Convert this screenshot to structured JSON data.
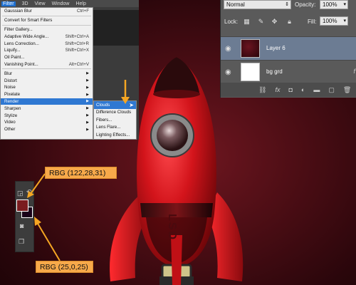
{
  "menubar": {
    "items": [
      "Filter",
      "3D",
      "View",
      "Window",
      "Help"
    ],
    "active": "Filter"
  },
  "filter_menu": {
    "top_item": {
      "label": "Gaussian Blur",
      "shortcut": "Ctrl+F"
    },
    "smart": "Convert for Smart Filters",
    "group1": [
      {
        "label": "Filter Gallery...",
        "shortcut": ""
      },
      {
        "label": "Adaptive Wide Angle...",
        "shortcut": "Shift+Ctrl+A"
      },
      {
        "label": "Lens Correction...",
        "shortcut": "Shift+Ctrl+R"
      },
      {
        "label": "Liquify...",
        "shortcut": "Shift+Ctrl+X"
      },
      {
        "label": "Oil Paint...",
        "shortcut": ""
      },
      {
        "label": "Vanishing Point...",
        "shortcut": "Alt+Ctrl+V"
      }
    ],
    "group2": [
      "Blur",
      "Distort",
      "Noise",
      "Pixelate",
      "Render",
      "Sharpen",
      "Stylize",
      "Video",
      "Other"
    ],
    "selected": "Render"
  },
  "render_submenu": {
    "items": [
      "Clouds",
      "Difference Clouds",
      "Fibers...",
      "Lens Flare...",
      "Lighting Effects..."
    ],
    "selected": "Clouds"
  },
  "layers_panel": {
    "blend_mode": "Normal",
    "opacity_label": "Opacity:",
    "opacity_value": "100%",
    "lock_label": "Lock:",
    "fill_label": "Fill:",
    "fill_value": "100%",
    "layers": [
      {
        "name": "Layer 6",
        "active": true
      },
      {
        "name": "bg grd",
        "active": false
      }
    ],
    "fx_mark": "f"
  },
  "swatches": {
    "foreground": "#7a1c1f",
    "background": "#190019"
  },
  "callouts": {
    "fg": "RBG (122,28,31)",
    "bg": "RBG (25,0,25)"
  },
  "rocket": {
    "label": "LSD"
  },
  "colors": {
    "accent_orange": "#f5a623",
    "menu_highlight": "#2f78d2",
    "rocket_red": "#d3141b"
  }
}
